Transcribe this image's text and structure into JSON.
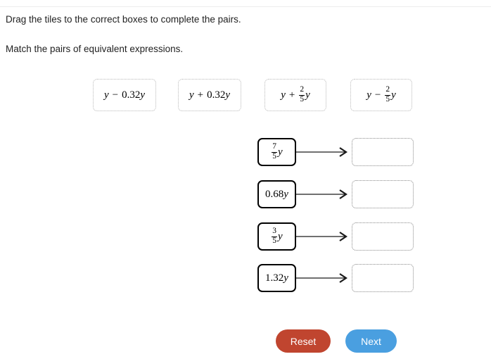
{
  "instructions": {
    "primary": "Drag the tiles to the correct boxes to complete the pairs.",
    "secondary": "Match the pairs of equivalent expressions."
  },
  "tiles": [
    {
      "id": "tile-y-minus-0.32y",
      "variable": "y",
      "operator": "−",
      "term_value": "0.32",
      "term_variable": "y",
      "text": "y − 0.32y"
    },
    {
      "id": "tile-y-plus-0.32y",
      "variable": "y",
      "operator": "+",
      "term_value": "0.32",
      "term_variable": "y",
      "text": "y + 0.32y"
    },
    {
      "id": "tile-y-plus-two-fifths-y",
      "variable": "y",
      "operator": "+",
      "numerator": "2",
      "denominator": "5",
      "term_variable": "y",
      "text": "y + 2/5 y"
    },
    {
      "id": "tile-y-minus-two-fifths-y",
      "variable": "y",
      "operator": "−",
      "numerator": "2",
      "denominator": "5",
      "term_variable": "y",
      "text": "y − 2/5 y"
    }
  ],
  "match_rows": [
    {
      "id": "row-seven-fifths-y",
      "source": {
        "kind": "fraction",
        "numerator": "7",
        "denominator": "5",
        "variable": "y",
        "text": "7/5 y"
      },
      "arrow": "right-arrow",
      "drop_box": {
        "value": "",
        "placeholder": ""
      }
    },
    {
      "id": "row-0.68y",
      "source": {
        "kind": "decimal",
        "value": "0.68",
        "variable": "y",
        "text": "0.68y"
      },
      "arrow": "right-arrow",
      "drop_box": {
        "value": "",
        "placeholder": ""
      }
    },
    {
      "id": "row-three-fifths-y",
      "source": {
        "kind": "fraction",
        "numerator": "3",
        "denominator": "5",
        "variable": "y",
        "text": "3/5 y"
      },
      "arrow": "right-arrow",
      "drop_box": {
        "value": "",
        "placeholder": ""
      }
    },
    {
      "id": "row-1.32y",
      "source": {
        "kind": "decimal",
        "value": "1.32",
        "variable": "y",
        "text": "1.32y"
      },
      "arrow": "right-arrow",
      "drop_box": {
        "value": "",
        "placeholder": ""
      }
    }
  ],
  "buttons": {
    "reset_label": "Reset",
    "next_label": "Next"
  },
  "colors": {
    "reset_background": "#c0452f",
    "next_background": "#4a9fe0",
    "button_text": "#ffffff",
    "page_background": "#ffffff",
    "text": "#1f1f1f",
    "source_box_border": "#000000",
    "drop_box_border": "#8a8a8a",
    "tile_border": "#b9b9b9"
  }
}
